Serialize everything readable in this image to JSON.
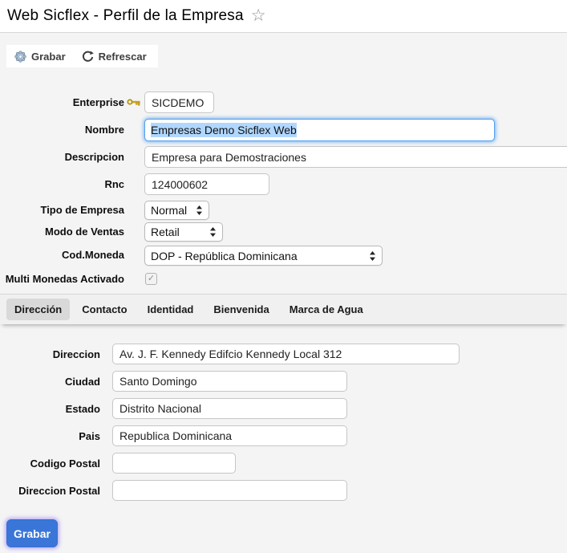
{
  "header": {
    "title": "Web Sicflex - Perfil de la Empresa"
  },
  "toolbar": {
    "grabar_label": "Grabar",
    "refrescar_label": "Refrescar"
  },
  "profile_form": {
    "enterprise": {
      "label": "Enterprise",
      "value": "SICDEMO"
    },
    "nombre": {
      "label": "Nombre",
      "value": "Empresas Demo Sicflex Web",
      "selected": true
    },
    "descripcion": {
      "label": "Descripcion",
      "value": "Empresa para Demostraciones"
    },
    "rnc": {
      "label": "Rnc",
      "value": "124000602"
    },
    "tipo_de_empresa": {
      "label": "Tipo de Empresa",
      "value": "Normal"
    },
    "modo_de_ventas": {
      "label": "Modo de Ventas",
      "value": "Retail"
    },
    "cod_moneda": {
      "label": "Cod.Moneda",
      "value": "DOP - República Dominicana"
    },
    "multi_monedas": {
      "label": "Multi Monedas Activado",
      "checked": true
    }
  },
  "tabs": {
    "items": [
      {
        "label": "Dirección",
        "active": true
      },
      {
        "label": "Contacto",
        "active": false
      },
      {
        "label": "Identidad",
        "active": false
      },
      {
        "label": "Bienvenida",
        "active": false
      },
      {
        "label": "Marca de Agua",
        "active": false
      }
    ]
  },
  "address_form": {
    "direccion": {
      "label": "Direccion",
      "value": "Av. J. F. Kennedy Edifcio Kennedy Local 312"
    },
    "ciudad": {
      "label": "Ciudad",
      "value": "Santo Domingo"
    },
    "estado": {
      "label": "Estado",
      "value": "Distrito Nacional"
    },
    "pais": {
      "label": "Pais",
      "value": "Republica Dominicana"
    },
    "codigo_postal": {
      "label": "Codigo Postal",
      "value": ""
    },
    "direccion_postal": {
      "label": "Direccion Postal",
      "value": ""
    }
  },
  "footer": {
    "grabar_label": "Grabar"
  },
  "icons": {
    "star": "favorite-star-outline",
    "key": "primary-key",
    "grabar": "seal-gear-save",
    "refrescar": "refresh-arrow",
    "selects": "updown-stepper-arrows"
  },
  "colors": {
    "page_bg": "#f4f4f4",
    "accent_button_blue": "#3a76d8",
    "focus_ring_blue": "#5ca7f0",
    "text_selection_blue": "#b0d7ff",
    "active_tab_gray": "#d9d9d9",
    "key_gold": "#e3b422"
  }
}
